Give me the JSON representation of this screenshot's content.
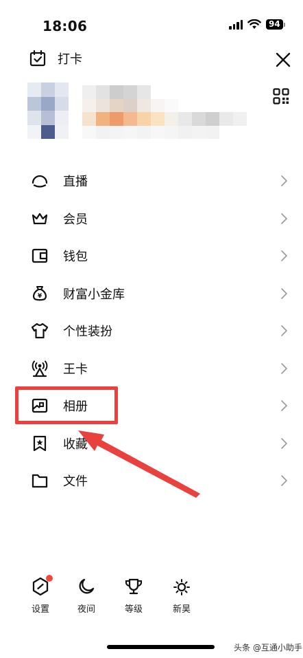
{
  "status_bar": {
    "time": "18:06",
    "battery": "94"
  },
  "top": {
    "checkin_label": "打卡"
  },
  "menu": {
    "items": [
      {
        "label": "直播",
        "icon": "live-icon"
      },
      {
        "label": "会员",
        "icon": "crown-icon"
      },
      {
        "label": "钱包",
        "icon": "wallet-icon"
      },
      {
        "label": "财富小金库",
        "icon": "money-bag-icon"
      },
      {
        "label": "个性装扮",
        "icon": "tshirt-icon"
      },
      {
        "label": "王卡",
        "icon": "antenna-icon"
      },
      {
        "label": "相册",
        "icon": "photo-album-icon"
      },
      {
        "label": "收藏",
        "icon": "bookmark-star-icon"
      },
      {
        "label": "文件",
        "icon": "folder-icon"
      }
    ],
    "highlighted": "相册"
  },
  "bottom_bar": {
    "items": [
      {
        "label": "设置",
        "icon": "settings-icon",
        "has_badge": true
      },
      {
        "label": "夜间",
        "icon": "moon-icon"
      },
      {
        "label": "等级",
        "icon": "trophy-icon"
      },
      {
        "label": "新昊",
        "icon": "sun-icon"
      }
    ]
  },
  "watermark": "头条 @互通小助手",
  "colors": {
    "accent_red": "#e8413e",
    "badge_red": "#f04a3e",
    "text": "#111111"
  }
}
